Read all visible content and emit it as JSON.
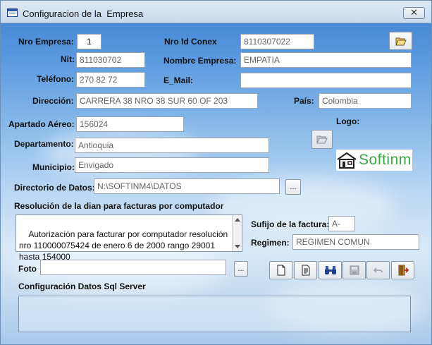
{
  "window": {
    "title": "Configuracion de la  Empresa",
    "close_glyph": "✕"
  },
  "labels": {
    "nro_empresa": "Nro Empresa:",
    "nro_id_conex": "Nro Id Conex",
    "nit": "Nit:",
    "nombre_empresa": "Nombre Empresa:",
    "telefono": "Teléfono:",
    "email": "E_Mail:",
    "direccion": "Dirección:",
    "pais": "País:",
    "apartado": "Apartado Aéreo:",
    "logo": "Logo:",
    "departamento": "Departamento:",
    "municipio": "Municipio:",
    "directorio": "Directorio de Datos:",
    "resolucion": "Resolución de la dian para facturas por computador",
    "sufijo": "Sufijo de la factura:",
    "regimen": "Regimen:",
    "foto": "Foto",
    "sql_server": "Configuración Datos Sql Server"
  },
  "values": {
    "nro_empresa": "1",
    "nro_id_conex": "8110307022",
    "nit": "811030702",
    "nombre_empresa": "EMPATIA",
    "telefono": "270 82 72",
    "email": "",
    "direccion": "CARRERA 38 NRO 38 SUR 60 OF 203",
    "pais": "Colombia",
    "apartado": "156024",
    "departamento": "Antioquia",
    "municipio": "Envigado",
    "directorio": "N:\\SOFTINM4\\DATOS",
    "resolucion": "Autorización para facturar por computador resolución nro 110000075424 de enero 6 de 2000 rango 29001 hasta 154000",
    "sufijo": "A-",
    "regimen": "REGIMEN COMUN",
    "foto": ""
  },
  "logo": {
    "text": "Softinm",
    "color": "#3aa640"
  },
  "buttons": {
    "browse_directorio": "...",
    "browse_foto": "..."
  },
  "icons": {
    "open_folder": "folder-open-icon",
    "logo_folder": "folder-open-icon",
    "new": "new-document-icon",
    "edit": "edit-document-icon",
    "search": "binoculars-icon",
    "save": "save-disk-icon",
    "undo": "undo-icon",
    "exit": "exit-door-icon"
  }
}
